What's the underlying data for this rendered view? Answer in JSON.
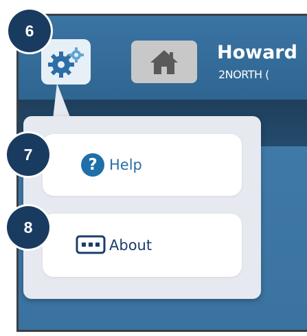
{
  "header": {
    "user_name": "Howard",
    "unit_name": "2NORTH (",
    "gear_icon": "gears-icon",
    "home_icon": "home-icon"
  },
  "menu": {
    "items": [
      {
        "label": "Help",
        "icon": "question-circle-icon"
      },
      {
        "label": "About",
        "icon": "monitor-dots-icon"
      }
    ]
  },
  "callouts": [
    "6",
    "7",
    "8"
  ],
  "colors": {
    "header_blue": "#3a74a3",
    "dark_band": "#1f3f5c",
    "badge_navy": "#1a3b60",
    "help_blue": "#1f6fa9"
  }
}
